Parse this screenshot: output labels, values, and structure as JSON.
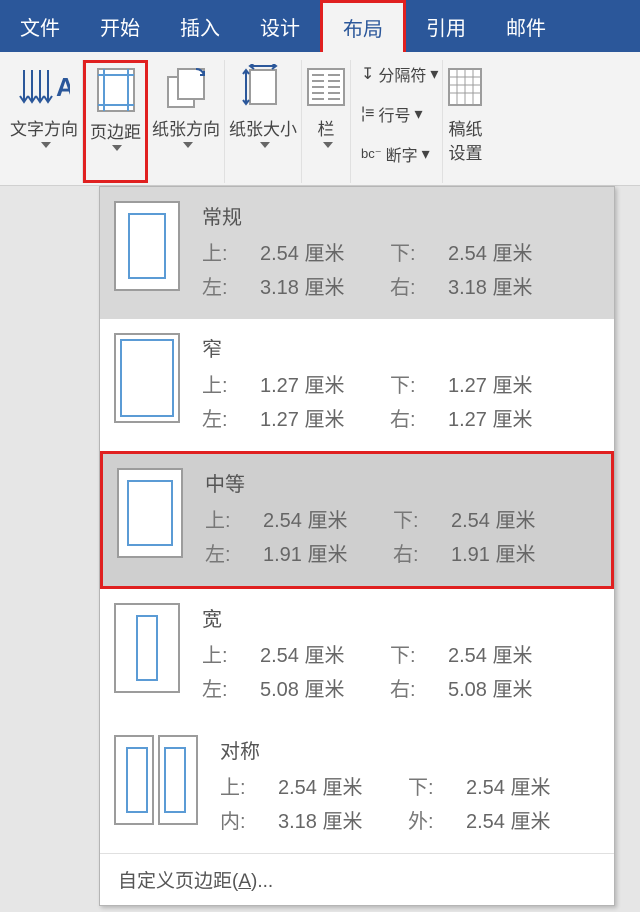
{
  "tabs": {
    "file": "文件",
    "home": "开始",
    "insert": "插入",
    "design": "设计",
    "layout": "布局",
    "references": "引用",
    "mail": "邮件"
  },
  "ribbon": {
    "text_direction": "文字方向",
    "margins": "页边距",
    "orientation": "纸张方向",
    "size": "纸张大小",
    "columns": "栏",
    "breaks": "分隔符",
    "line_numbers": "行号",
    "hyphenation": "断字",
    "manuscript": "稿纸\n设置"
  },
  "margin_presets": [
    {
      "name": "常规",
      "labels": {
        "top": "上:",
        "bottom": "下:",
        "left": "左:",
        "right": "右:"
      },
      "top": "2.54 厘米",
      "bottom": "2.54 厘米",
      "left": "3.18 厘米",
      "right": "3.18 厘米"
    },
    {
      "name": "窄",
      "labels": {
        "top": "上:",
        "bottom": "下:",
        "left": "左:",
        "right": "右:"
      },
      "top": "1.27 厘米",
      "bottom": "1.27 厘米",
      "left": "1.27 厘米",
      "right": "1.27 厘米"
    },
    {
      "name": "中等",
      "labels": {
        "top": "上:",
        "bottom": "下:",
        "left": "左:",
        "right": "右:"
      },
      "top": "2.54 厘米",
      "bottom": "2.54 厘米",
      "left": "1.91 厘米",
      "right": "1.91 厘米"
    },
    {
      "name": "宽",
      "labels": {
        "top": "上:",
        "bottom": "下:",
        "left": "左:",
        "right": "右:"
      },
      "top": "2.54 厘米",
      "bottom": "2.54 厘米",
      "left": "5.08 厘米",
      "right": "5.08 厘米"
    },
    {
      "name": "对称",
      "labels": {
        "top": "上:",
        "bottom": "下:",
        "inside": "内:",
        "outside": "外:"
      },
      "top": "2.54 厘米",
      "bottom": "2.54 厘米",
      "left": "3.18 厘米",
      "right": "2.54 厘米"
    }
  ],
  "custom_margins": "自定义页边距(A)..."
}
